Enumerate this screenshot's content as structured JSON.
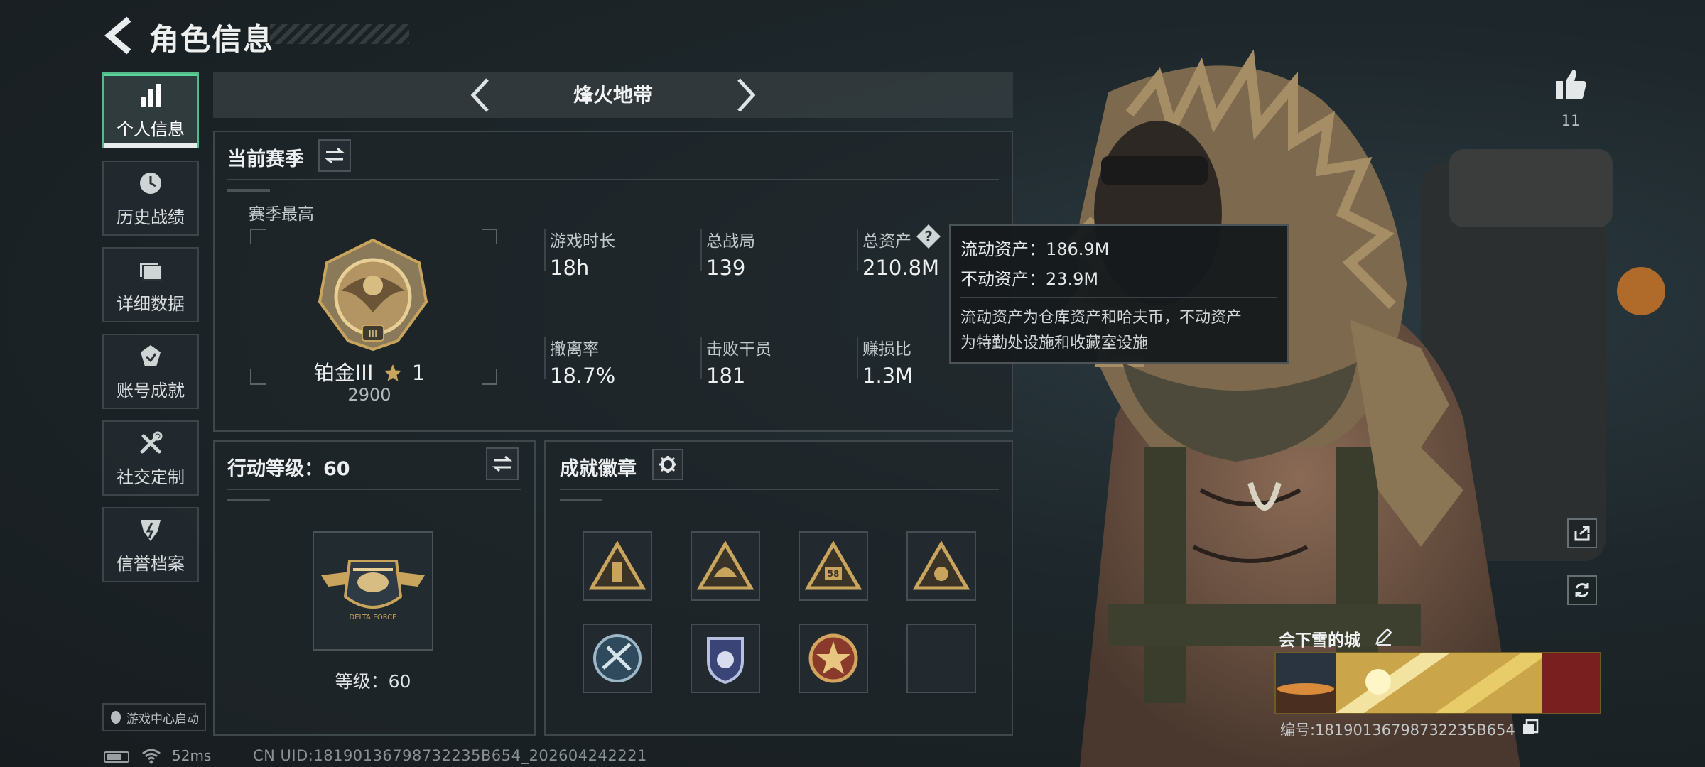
{
  "header": {
    "title": "角色信息"
  },
  "nav": {
    "items": [
      {
        "label": "个人信息",
        "icon": "bar-chart-icon",
        "active": true
      },
      {
        "label": "历史战绩",
        "icon": "history-clock-icon",
        "active": false
      },
      {
        "label": "详细数据",
        "icon": "folder-icon",
        "active": false
      },
      {
        "label": "账号成就",
        "icon": "medal-icon",
        "active": false
      },
      {
        "label": "社交定制",
        "icon": "wrench-icon",
        "active": false
      },
      {
        "label": "信誉档案",
        "icon": "shield-bolt-icon",
        "active": false
      }
    ],
    "launch_label": "游戏中心启动"
  },
  "status": {
    "ping": "52ms",
    "uid_line": "CN UID:18190136798732235B654_202604242221"
  },
  "mode_selector": {
    "name": "烽火地带"
  },
  "season": {
    "title": "当前赛季",
    "best_label": "赛季最高",
    "rank_name": "铂金III",
    "rank_stars": "1",
    "rank_score": "2900",
    "stats": [
      {
        "label": "游戏时长",
        "value": "18h"
      },
      {
        "label": "总战局",
        "value": "139"
      },
      {
        "label": "总资产",
        "value": "210.8M"
      },
      {
        "label": "撤离率",
        "value": "18.7%"
      },
      {
        "label": "击败干员",
        "value": "181"
      },
      {
        "label": "赚损比",
        "value": "1.3M"
      }
    ]
  },
  "tooltip": {
    "liquid": "流动资产：186.9M",
    "fixed": "不动资产：23.9M",
    "desc_line1": "流动资产为仓库资产和哈夫币，不动资产",
    "desc_line2": "为特勤处设施和收藏室设施"
  },
  "level": {
    "title": "行动等级：60",
    "badge_text": "DELTA FORCE",
    "level_label": "等级：60"
  },
  "achievements": {
    "title": "成就徽章",
    "badge_number": "58",
    "slots": [
      "gold-triangle-soldier",
      "gold-triangle-helmet",
      "gold-triangle-58",
      "gold-triangle-emblem",
      "blue-crest-arrows",
      "blue-shield-stars",
      "red-star-seal",
      "empty"
    ]
  },
  "profile": {
    "likes": "11",
    "name": "会下雪的城",
    "id_line": "编号:18190136798732235B654"
  },
  "colors": {
    "accent_green": "#5ad49a",
    "gold": "#c9a45c",
    "panel_border": "#3e474b"
  }
}
